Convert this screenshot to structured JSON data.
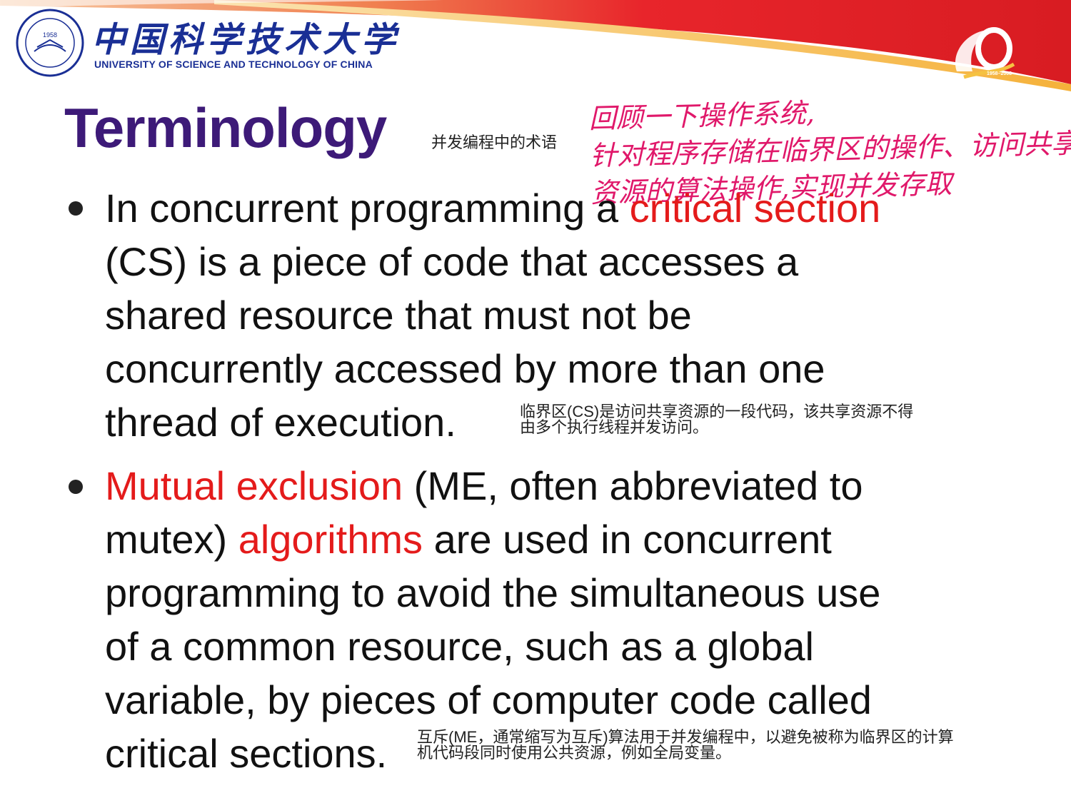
{
  "header": {
    "logo_cn": "中国科学技术大学",
    "logo_en": "UNIVERSITY OF SCIENCE AND TECHNOLOGY OF CHINA",
    "seal_year": "1958",
    "anniv_years": "1958–2008"
  },
  "title": "Terminology",
  "title_note": "并发编程中的术语",
  "handwriting": {
    "line1": "回顾一下操作系统,",
    "line2": "针对程序存储在临界区的操作、访问共享",
    "line3": "资源的算法操作,实现并发存取"
  },
  "bullets": [
    {
      "lines": [
        {
          "pre": "In concurrent programming a ",
          "red": "critical section",
          "post": ""
        },
        {
          "pre": "(CS) is a piece of code that accesses a",
          "red": "",
          "post": ""
        },
        {
          "pre": "shared resource that must not be",
          "red": "",
          "post": ""
        },
        {
          "pre": "concurrently accessed by more than one",
          "red": "",
          "post": ""
        },
        {
          "pre": "thread of execution.",
          "red": "",
          "post": ""
        }
      ],
      "note_line1": "临界区(CS)是访问共享资源的一段代码，该共享资源不得",
      "note_line2": "由多个执行线程并发访问。"
    },
    {
      "lines": [
        {
          "pre": "",
          "red": "Mutual exclusion",
          "post": " (ME, often abbreviated to"
        },
        {
          "pre": "mutex) ",
          "red": "algorithms",
          "post": " are used in concurrent"
        },
        {
          "pre": "programming to avoid the simultaneous use",
          "red": "",
          "post": ""
        },
        {
          "pre": "of a common resource, such as a global",
          "red": "",
          "post": ""
        },
        {
          "pre": "variable, by pieces of computer code called",
          "red": "",
          "post": ""
        },
        {
          "pre": "critical sections.",
          "red": "",
          "post": ""
        }
      ],
      "note_line1": "互斥(ME，通常缩写为互斥)算法用于并发编程中，以避免被称为临界区的计算",
      "note_line2": "机代码段同时使用公共资源，例如全局变量。"
    }
  ],
  "colors": {
    "title": "#3d1a78",
    "highlight": "#e41b1b",
    "handwriting": "#e0186a",
    "logo_blue": "#1a2f95",
    "header_red": "#e8252b"
  }
}
